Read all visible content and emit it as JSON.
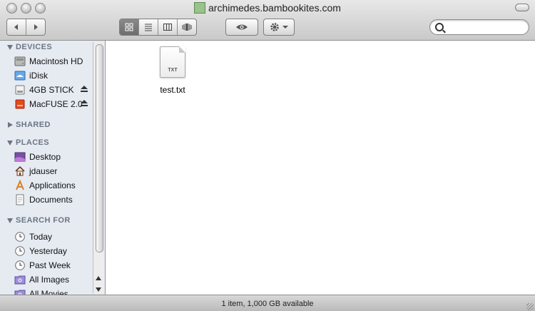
{
  "window": {
    "title": "archimedes.bambookites.com"
  },
  "toolbar": {
    "back_icon": "chevron-left-icon",
    "forward_icon": "chevron-right-icon",
    "view_modes": [
      "icon-view",
      "list-view",
      "column-view",
      "cover-flow-view"
    ],
    "active_view": "icon-view",
    "quick_look_icon": "eye-icon",
    "action_icon": "gear-icon",
    "search_placeholder": ""
  },
  "sidebar": {
    "sections": {
      "devices": "DEVICES",
      "shared": "SHARED",
      "places": "PLACES",
      "search_for": "SEARCH FOR"
    },
    "devices": [
      {
        "label": "Macintosh HD",
        "icon": "hard-drive-icon"
      },
      {
        "label": "iDisk",
        "icon": "idisk-icon"
      },
      {
        "label": "4GB STICK",
        "icon": "usb-drive-icon",
        "eject": true
      },
      {
        "label": "MacFUSE 2.0",
        "icon": "macfuse-volume-icon",
        "eject": true
      }
    ],
    "places": [
      {
        "label": "Desktop",
        "icon": "desktop-folder-icon"
      },
      {
        "label": "jdauser",
        "icon": "home-icon"
      },
      {
        "label": "Applications",
        "icon": "applications-icon"
      },
      {
        "label": "Documents",
        "icon": "documents-icon"
      }
    ],
    "search_for": [
      {
        "label": "Today",
        "icon": "clock-icon"
      },
      {
        "label": "Yesterday",
        "icon": "clock-icon"
      },
      {
        "label": "Past Week",
        "icon": "clock-icon"
      },
      {
        "label": "All Images",
        "icon": "smart-folder-icon"
      },
      {
        "label": "All Movies",
        "icon": "smart-folder-icon"
      }
    ]
  },
  "content": {
    "files": [
      {
        "name": "test.txt",
        "badge": "TXT",
        "icon": "text-file-icon"
      }
    ]
  },
  "status": {
    "text": "1 item, 1,000 GB available"
  },
  "colors": {
    "sidebar_bg": "#e6ebf2",
    "section_header": "#6c7585",
    "toolbar_top": "#e8e8e8",
    "toolbar_bottom": "#c9c9c9"
  }
}
